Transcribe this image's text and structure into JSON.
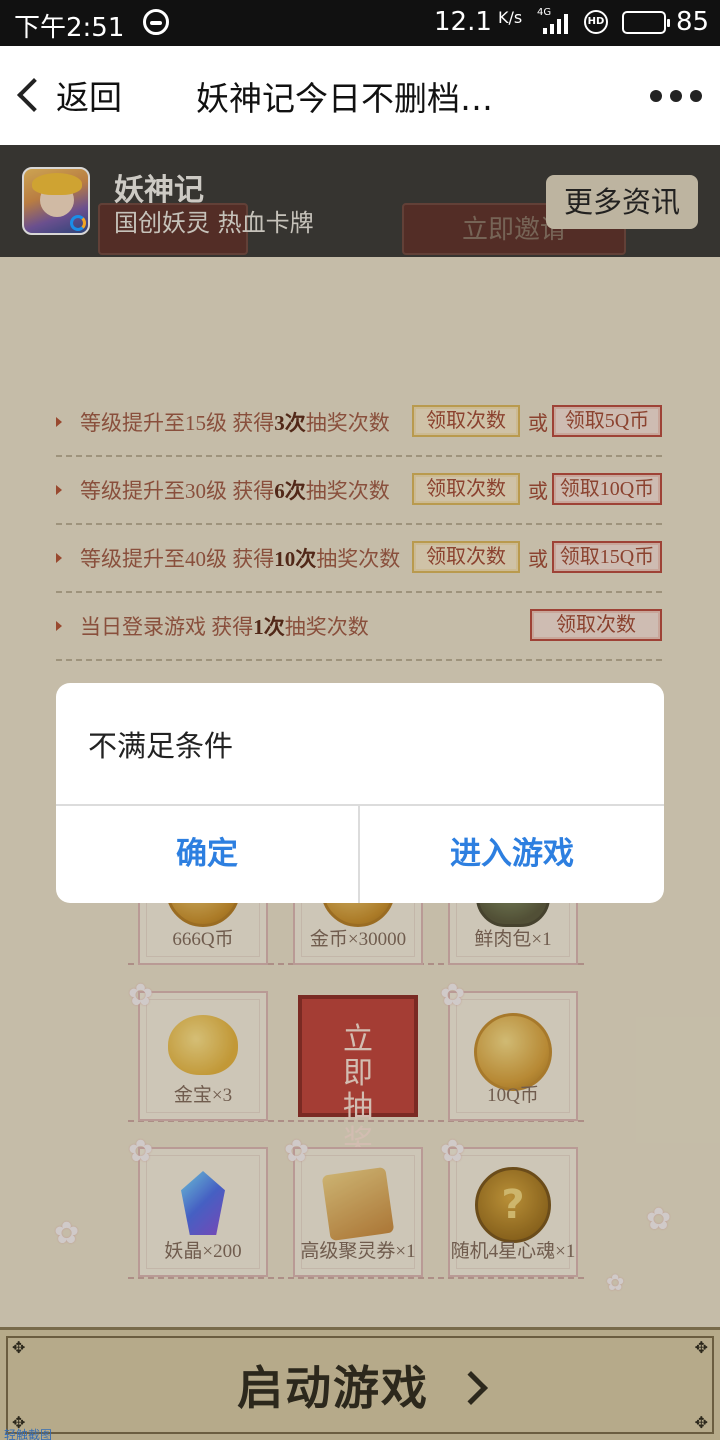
{
  "status_bar": {
    "time": "下午2:51",
    "net_speed": "12.1",
    "net_speed_unit": "K/s",
    "network": "4G",
    "hd": "HD",
    "battery_level": "85",
    "battery_color": "#f5c21b"
  },
  "nav": {
    "back_label": "返回",
    "title": "妖神记今日不删档…"
  },
  "app_header": {
    "name": "妖神记",
    "subtitle": "国创妖灵 热血卡牌",
    "more_news": "更多资讯",
    "hidden_button": "立即邀请"
  },
  "rules": [
    {
      "prefix": "等级提升至15级 获得",
      "count": "3次",
      "suffix": "抽奖次数",
      "claim": "领取次数",
      "or": "或",
      "coin_claim": "领取5Q币"
    },
    {
      "prefix": "等级提升至30级 获得",
      "count": "6次",
      "suffix": "抽奖次数",
      "claim": "领取次数",
      "or": "或",
      "coin_claim": "领取10Q币"
    },
    {
      "prefix": "等级提升至40级 获得",
      "count": "10次",
      "suffix": "抽奖次数",
      "claim": "领取次数",
      "or": "或",
      "coin_claim": "领取15Q币"
    },
    {
      "prefix": "当日登录游戏 获得",
      "count": "1次",
      "suffix": "抽奖次数",
      "claim": "领取次数"
    }
  ],
  "prizes": {
    "row1": [
      "666Q币",
      "金币×30000",
      "鲜肉包×1"
    ],
    "row2_left": "金宝×3",
    "draw_button": "立即抽奖",
    "row2_right": "10Q币",
    "row3": [
      "妖晶×200",
      "高级聚灵券×1",
      "随机4星心魂×1"
    ]
  },
  "launch_button": "启动游戏",
  "watermark": "轻触截图",
  "dialog": {
    "message": "不满足条件",
    "confirm": "确定",
    "enter_game": "进入游戏",
    "button_color": "#2d7fe0"
  }
}
